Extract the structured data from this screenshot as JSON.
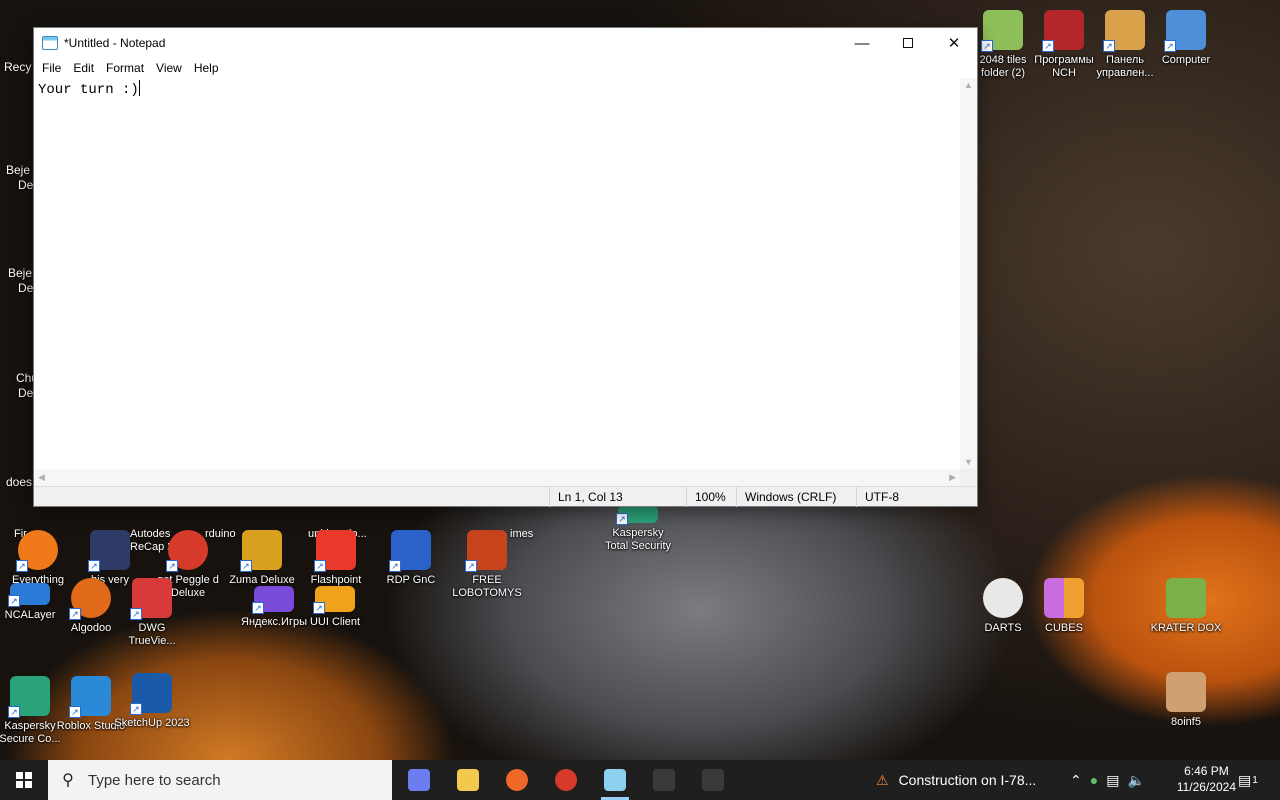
{
  "notepad": {
    "title": "*Untitled - Notepad",
    "menu": [
      "File",
      "Edit",
      "Format",
      "View",
      "Help"
    ],
    "content": "Your turn :)",
    "status": {
      "position": "Ln 1, Col 13",
      "zoom": "100%",
      "line_ending": "Windows (CRLF)",
      "encoding": "UTF-8"
    }
  },
  "desktop_icons_right": [
    {
      "label": "2048 tiles folder (2)",
      "color": "#8fbf5a"
    },
    {
      "label": "Программы NCH",
      "color": "#b3262a"
    },
    {
      "label": "Панель управлен...",
      "color": "#d9a24a"
    },
    {
      "label": "Computer",
      "color": "#4d8fd8"
    },
    {
      "label": "Kaspersky Total Security",
      "color": "#2aa37a"
    },
    {
      "label": "DARTS",
      "color": "#e8e8e8"
    },
    {
      "label": "CUBES",
      "color": "#c86de0"
    },
    {
      "label": "KRATER DOX",
      "color": "#7bb04a"
    },
    {
      "label": "8oinf5",
      "color": "#d0a070"
    }
  ],
  "desktop_icons_bottom": [
    {
      "label": "Everything",
      "color": "#f07a1a"
    },
    {
      "label": "his very",
      "color": "#2f3a66"
    },
    {
      "label": "get Peggle d Deluxe",
      "color": "#d63a2a"
    },
    {
      "label": "Zuma Deluxe",
      "color": "#d9a020"
    },
    {
      "label": "Flashpoint",
      "color": "#e8392a"
    },
    {
      "label": "RDP GnC",
      "color": "#2a62c9"
    },
    {
      "label": "FREE LOBOTOMYS",
      "color": "#c8421c"
    },
    {
      "label": "NCALayer",
      "color": "#2a7bd8"
    },
    {
      "label": "Algodoo",
      "color": "#e06a1a"
    },
    {
      "label": "DWG TrueVie...",
      "color": "#d83a3a"
    },
    {
      "label": "Яндекс.Игры",
      "color": "#7a4ad8"
    },
    {
      "label": "UUI Client",
      "color": "#f0a21a"
    },
    {
      "label": "Kaspersky Secure Co...",
      "color": "#2aa37a"
    },
    {
      "label": "Roblox Studio",
      "color": "#2a8ad8"
    },
    {
      "label": "SketchUp 2023",
      "color": "#1a5aa8"
    }
  ],
  "desktop_partial_labels": [
    "Recy",
    "Beje",
    "De",
    "Beje",
    "De",
    "Chu",
    "De",
    "does",
    "Fir",
    "Autodes ReCap 20",
    "rduino",
    "unidownlo...",
    "imes"
  ],
  "taskbar": {
    "search_placeholder": "Type here to search",
    "apps": [
      {
        "name": "copilot",
        "color": "#6a7ef0"
      },
      {
        "name": "file-explorer",
        "color": "#f2c94c"
      },
      {
        "name": "firefox",
        "color": "#f0672a"
      },
      {
        "name": "peggle",
        "color": "#d63a2a"
      },
      {
        "name": "notepad",
        "color": "#8fd0f0"
      },
      {
        "name": "app-dim-1",
        "color": "#3a3a3a"
      },
      {
        "name": "app-dim-2",
        "color": "#3a3a3a"
      }
    ],
    "news": "Construction on I-78...",
    "time": "6:46 PM",
    "date": "11/26/2024",
    "notifications": "1"
  }
}
